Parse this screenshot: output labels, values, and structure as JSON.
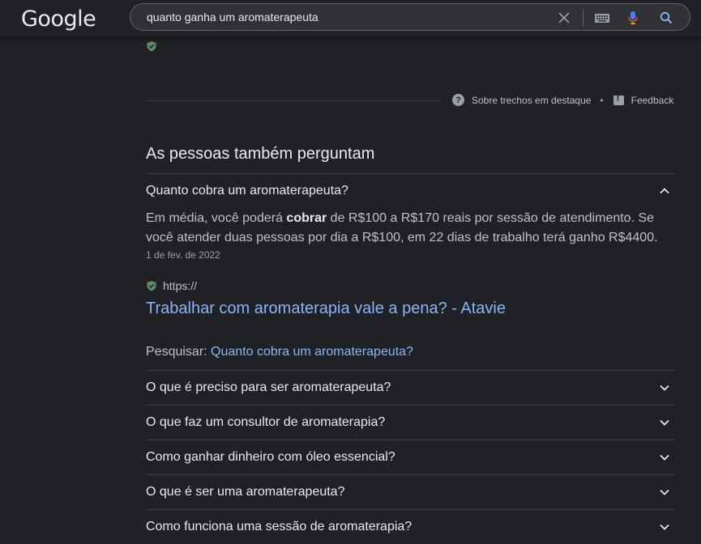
{
  "header": {
    "logo": "Google",
    "query": "quanto ganha um aromaterapeuta"
  },
  "snippet_links": {
    "about": "Sobre trechos em destaque",
    "separator": "•",
    "feedback": "Feedback"
  },
  "paa": {
    "title": "As pessoas também perguntam",
    "expanded": {
      "question": "Quanto cobra um aromaterapeuta?",
      "answer_pre": "Em média, você poderá ",
      "answer_bold": "cobrar",
      "answer_post": " de R$100 a R$170 reais por sessão de atendimento. Se você atender duas pessoas por dia a R$100, em 22 dias de trabalho terá ganho R$4400.",
      "date": "1 de fev. de 2022",
      "source_url": "https://",
      "source_title": "Trabalhar com aromaterapia vale a pena? - Atavie",
      "search_label": "Pesquisar: ",
      "search_link": "Quanto cobra um aromaterapeuta?"
    },
    "questions": [
      "O que é preciso para ser aromaterapeuta?",
      "O que faz um consultor de aromaterapia?",
      "Como ganhar dinheiro com óleo essencial?",
      "O que é ser uma aromaterapeuta?",
      "Como funciona uma sessão de aromaterapia?"
    ]
  },
  "colors": {
    "background": "#202124",
    "link": "#8ab4f8",
    "text": "#bdc1c6",
    "heading": "#e8eaed"
  },
  "icons": [
    "clear-icon",
    "keyboard-icon",
    "mic-icon",
    "search-icon",
    "shield-icon",
    "help-icon",
    "feedback-icon",
    "chevron-up-icon",
    "chevron-down-icon"
  ]
}
